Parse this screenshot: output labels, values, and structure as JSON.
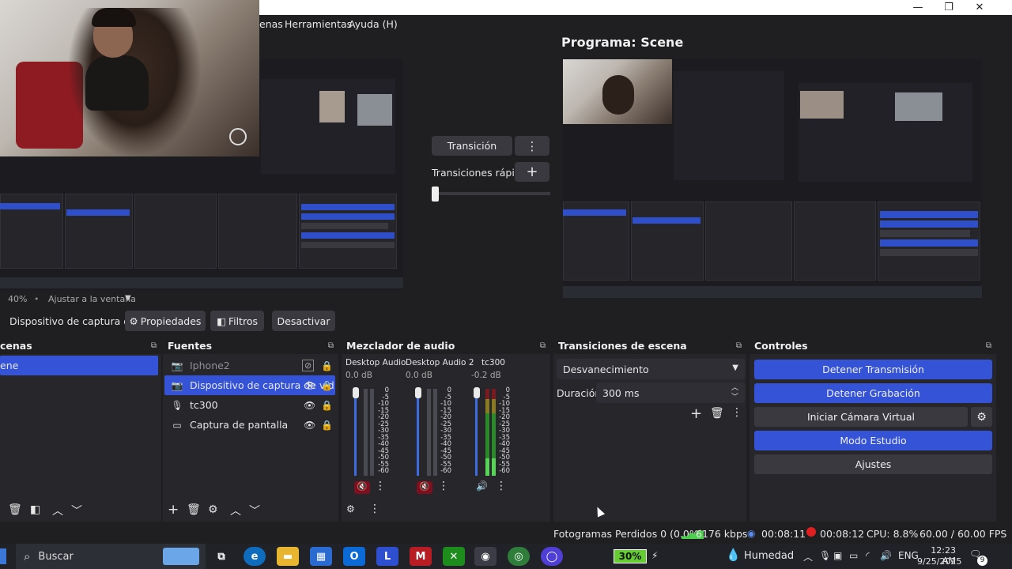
{
  "window": {
    "minimize": "—",
    "maximize": "❐",
    "close": "✕"
  },
  "menu": {
    "items": [
      "enas",
      "Herramientas",
      "Ayuda (H)"
    ]
  },
  "program": {
    "title": "Programa: Scene"
  },
  "preview": {
    "zoom": "40%",
    "fit_label": "Ajustar a la ventana"
  },
  "transition": {
    "button_label": "Transición",
    "quick_label": "Transiciones rápidas"
  },
  "context_bar": {
    "source_name": "Dispositivo de captura de v",
    "properties": "Propiedades",
    "filters": "Filtros",
    "deactivate": "Desactivar"
  },
  "scenes": {
    "title": "cenas",
    "items": [
      "ene"
    ]
  },
  "sources": {
    "title": "Fuentes",
    "items": [
      {
        "label": "Iphone2",
        "icon": "camera-icon",
        "state": "hidden"
      },
      {
        "label": "Dispositivo de captura de vid",
        "icon": "camera-icon",
        "state": "selected"
      },
      {
        "label": "tc300",
        "icon": "microphone-icon",
        "state": "normal"
      },
      {
        "label": "Captura de pantalla",
        "icon": "monitor-icon",
        "state": "normal"
      }
    ]
  },
  "mixer": {
    "title": "Mezclador de audio",
    "channels": [
      {
        "name": "Desktop Audio",
        "db": "0.0 dB",
        "level": 0.0
      },
      {
        "name": "Desktop Audio 2",
        "db": "0.0 dB",
        "level": 0.0
      },
      {
        "name": "tc300",
        "db": "-0.2 dB",
        "level": 0.9
      }
    ],
    "scale": [
      "0",
      "-5",
      "-10",
      "-15",
      "-20",
      "-25",
      "-30",
      "-35",
      "-40",
      "-45",
      "-50",
      "-55",
      "-60"
    ]
  },
  "scene_transitions": {
    "title": "Transiciones de escena",
    "selected": "Desvanecimiento",
    "duration_label": "Duración",
    "duration_value": "300 ms"
  },
  "controls": {
    "title": "Controles",
    "stop_stream": "Detener Transmisión",
    "stop_record": "Detener Grabación",
    "virtual_cam": "Iniciar Cámara Virtual",
    "studio_mode": "Modo Estudio",
    "settings": "Ajustes"
  },
  "status": {
    "dropped": "Fotogramas Perdidos 0 (0.0%)",
    "bitrate": "6176 kbps",
    "stream_time": "00:08:11",
    "rec_time": "00:08:12",
    "cpu": "CPU: 8.8%",
    "fps": "60.00 / 60.00 FPS"
  },
  "taskbar": {
    "search_placeholder": "Buscar",
    "battery": "30%",
    "weather": "Humedad",
    "lang": "ENG",
    "time": "12:23 AM",
    "date": "9/25/2025",
    "notif_count": "9"
  },
  "colors": {
    "accent": "#3453d6",
    "bg": "#1f1e21",
    "dock": "#27262b"
  }
}
